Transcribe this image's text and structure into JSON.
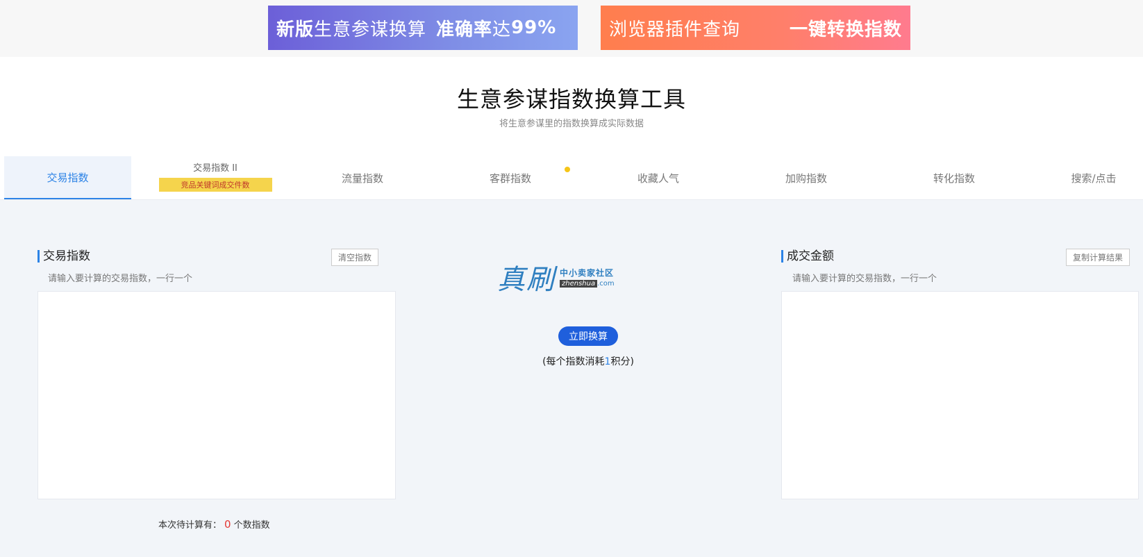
{
  "banners": {
    "left": {
      "part1": "新版",
      "part2": "生意参谋换算",
      "part3": "准确率",
      "part4": "达",
      "part5": "99%"
    },
    "right": {
      "part1": "浏览器插件查询",
      "part2": "一键转换指数"
    }
  },
  "header": {
    "title": "生意参谋指数换算工具",
    "subtitle": "将生意参谋里的指数换算成实际数据"
  },
  "tabs": [
    {
      "label": "交易指数"
    },
    {
      "label": "交易指数 II",
      "badge": "竞品关键词成交件数"
    },
    {
      "label": "流量指数"
    },
    {
      "label": "客群指数"
    },
    {
      "label": "收藏人气"
    },
    {
      "label": "加购指数"
    },
    {
      "label": "转化指数"
    },
    {
      "label": "搜索/点击"
    }
  ],
  "left_panel": {
    "title": "交易指数",
    "clear_label": "清空指数",
    "hint": "请输入要计算的交易指数，一行一个",
    "count_prefix": "本次待计算有：",
    "count_value": "0",
    "count_suffix": "个数指数"
  },
  "right_panel": {
    "title": "成交金额",
    "copy_label": "复制计算结果",
    "hint": "请输入要计算的交易指数，一行一个"
  },
  "center": {
    "logo_main": "真刷",
    "logo_cn": "中小卖家社区",
    "logo_en": "zhenshua",
    "logo_domain": ".com",
    "calc_label": "立即换算",
    "cost_prefix": "(每个指数消耗",
    "cost_value": "1",
    "cost_suffix": "积分)"
  }
}
